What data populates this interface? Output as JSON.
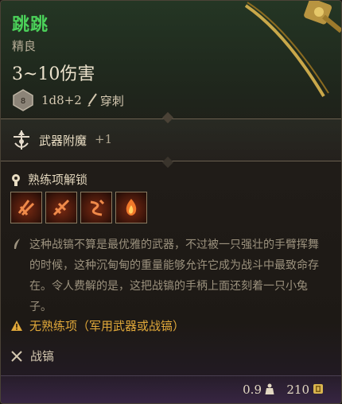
{
  "item": {
    "name": "跳跳",
    "rarity": "精良",
    "damage": "3~10伤害",
    "die_face": "8",
    "dice": "1d8+2",
    "damage_type": "穿刺"
  },
  "enchant": {
    "label": "武器附魔",
    "value": "+1"
  },
  "unlock": {
    "label": "熟练项解锁",
    "actions": [
      "action-slash-icon",
      "action-cleave-icon",
      "action-lacerate-icon",
      "action-fire-icon"
    ]
  },
  "description": "这种战镐不算是最优雅的武器，不过被一只强壮的手臂挥舞的时候，这种沉甸甸的重量能够允许它成为战斗中最致命存在。令人费解的是，这把战镐的手柄上面还刻着一只小兔子。",
  "warning": "无熟练项（军用武器或战镐）",
  "proficiency": "战镐",
  "footer": {
    "weight": "0.9",
    "price": "210"
  },
  "colors": {
    "name": "#4bd25a",
    "warning": "#e0a83a",
    "border": "#4a4236"
  }
}
